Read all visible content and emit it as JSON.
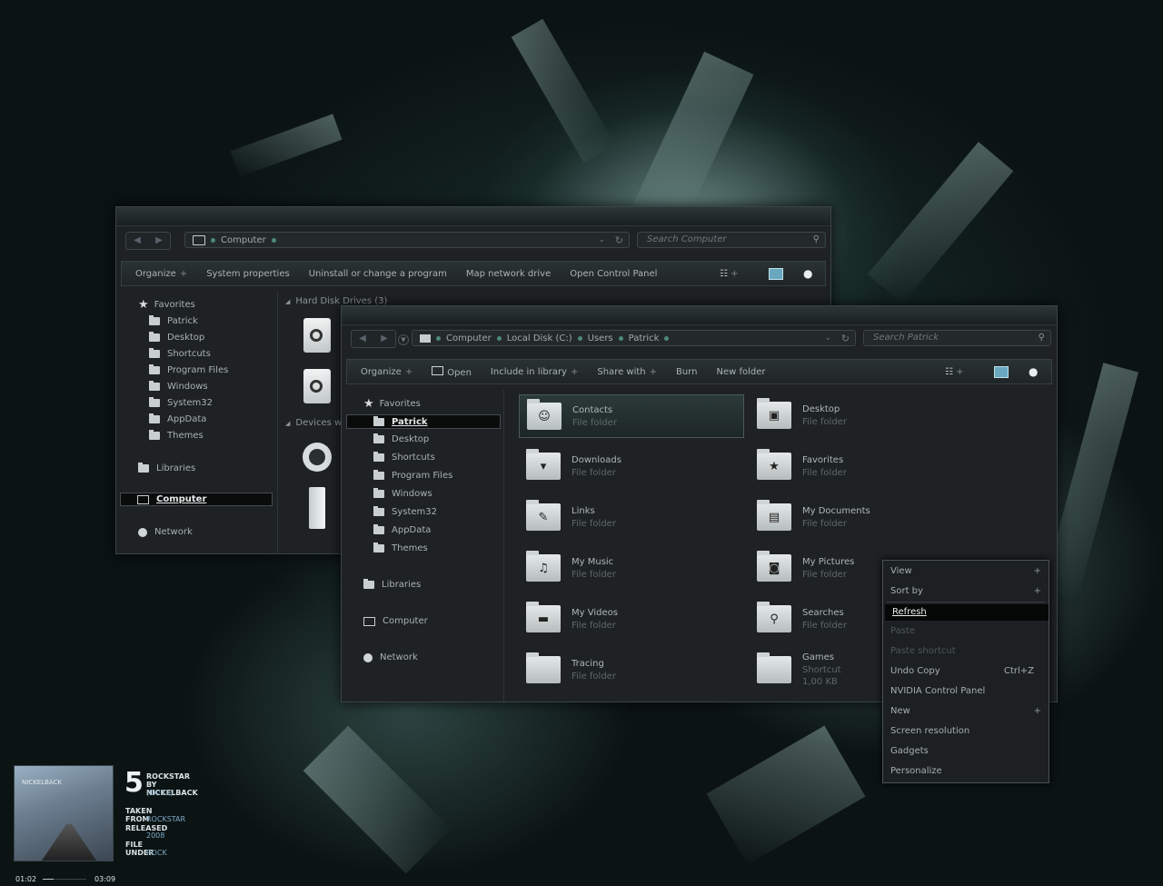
{
  "win_back": {
    "address": {
      "crumbs": [
        "Computer"
      ]
    },
    "search_placeholder": "Search Computer",
    "toolbar": [
      "Organize",
      "System properties",
      "Uninstall or change a program",
      "Map network drive",
      "Open Control Panel"
    ],
    "nav": {
      "favorites": "Favorites",
      "items": [
        "Patrick",
        "Desktop",
        "Shortcuts",
        "Program Files",
        "Windows",
        "System32",
        "AppData",
        "Themes"
      ],
      "libraries": "Libraries",
      "computer": "Computer",
      "network": "Network"
    },
    "groups": [
      "Hard Disk Drives (3)",
      "Devices wit"
    ]
  },
  "win_front": {
    "address": {
      "crumbs": [
        "Computer",
        "Local Disk (C:)",
        "Users",
        "Patrick"
      ]
    },
    "search_placeholder": "Search Patrick",
    "toolbar": [
      "Organize",
      "Open",
      "Include in library",
      "Share with",
      "Burn",
      "New folder"
    ],
    "nav": {
      "favorites": "Favorites",
      "items": [
        "Patrick",
        "Desktop",
        "Shortcuts",
        "Program Files",
        "Windows",
        "System32",
        "AppData",
        "Themes"
      ],
      "libraries": "Libraries",
      "computer": "Computer",
      "network": "Network"
    },
    "tiles": [
      {
        "name": "Contacts",
        "sub": "File folder",
        "icon": "contacts-icon"
      },
      {
        "name": "Desktop",
        "sub": "File folder",
        "icon": "desktop-icon"
      },
      {
        "name": "Downloads",
        "sub": "File folder",
        "icon": "download-icon"
      },
      {
        "name": "Favorites",
        "sub": "File folder",
        "icon": "star-icon"
      },
      {
        "name": "Links",
        "sub": "File folder",
        "icon": "wrench-icon"
      },
      {
        "name": "My Documents",
        "sub": "File folder",
        "icon": "document-icon"
      },
      {
        "name": "My Music",
        "sub": "File folder",
        "icon": "music-icon"
      },
      {
        "name": "My Pictures",
        "sub": "File folder",
        "icon": "camera-icon"
      },
      {
        "name": "My Videos",
        "sub": "File folder",
        "icon": "clapper-icon"
      },
      {
        "name": "Searches",
        "sub": "File folder",
        "icon": "magnifier-icon"
      },
      {
        "name": "Tracing",
        "sub": "File folder",
        "icon": "folder-icon"
      },
      {
        "name": "Games",
        "sub": "Shortcut",
        "sub2": "1,00 KB",
        "icon": "folder-icon"
      }
    ]
  },
  "context_menu": [
    {
      "label": "View",
      "arrow": true
    },
    {
      "label": "Sort by",
      "arrow": true
    },
    {
      "label": "Refresh",
      "highlight": true
    },
    {
      "label": "Paste",
      "disabled": true
    },
    {
      "label": "Paste shortcut",
      "disabled": true
    },
    {
      "label": "Undo Copy",
      "shortcut": "Ctrl+Z"
    },
    {
      "label": "NVIDIA Control Panel"
    },
    {
      "label": "New",
      "arrow": true
    },
    {
      "label": "Screen resolution"
    },
    {
      "label": "Gadgets"
    },
    {
      "label": "Personalize"
    }
  ],
  "media": {
    "track_number": "5",
    "title": "ROCKSTAR",
    "artist": "BY NICKELBACK",
    "length": "(04:11)",
    "taken_from_label": "TAKEN FROM",
    "album": "ROCKSTAR",
    "released_label": "RELEASED",
    "year": "2008",
    "genre_label": "FILE UNDER",
    "genre": "ROCK",
    "elapsed": "01:02",
    "remaining": "03:09",
    "cover_text": "NICKELBACK",
    "progress": 0.25
  }
}
